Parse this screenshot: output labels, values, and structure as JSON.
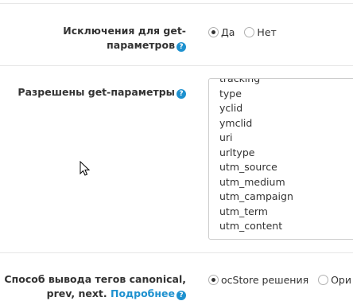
{
  "exceptions": {
    "label_line1": "Исключения для get-",
    "label_line2": "параметров",
    "options": [
      {
        "label": "Да",
        "checked": true
      },
      {
        "label": "Нет",
        "checked": false
      }
    ]
  },
  "allowed": {
    "label": "Разрешены get-параметры",
    "items": [
      "tracking",
      "type",
      "yclid",
      "ymclid",
      "uri",
      "urltype",
      "utm_source",
      "utm_medium",
      "utm_campaign",
      "utm_term",
      "utm_content"
    ]
  },
  "canonical": {
    "label_line1": "Способ вывода тегов canonical,",
    "label_line2_prefix": "prev, next.",
    "more_link": "Подробнее",
    "options": [
      {
        "label": "ocStore решения",
        "checked": true
      },
      {
        "label": "Ори",
        "checked": false
      }
    ]
  },
  "help_icon": "?",
  "colors": {
    "accent": "#1e91cf",
    "border": "#e6e6e6"
  }
}
